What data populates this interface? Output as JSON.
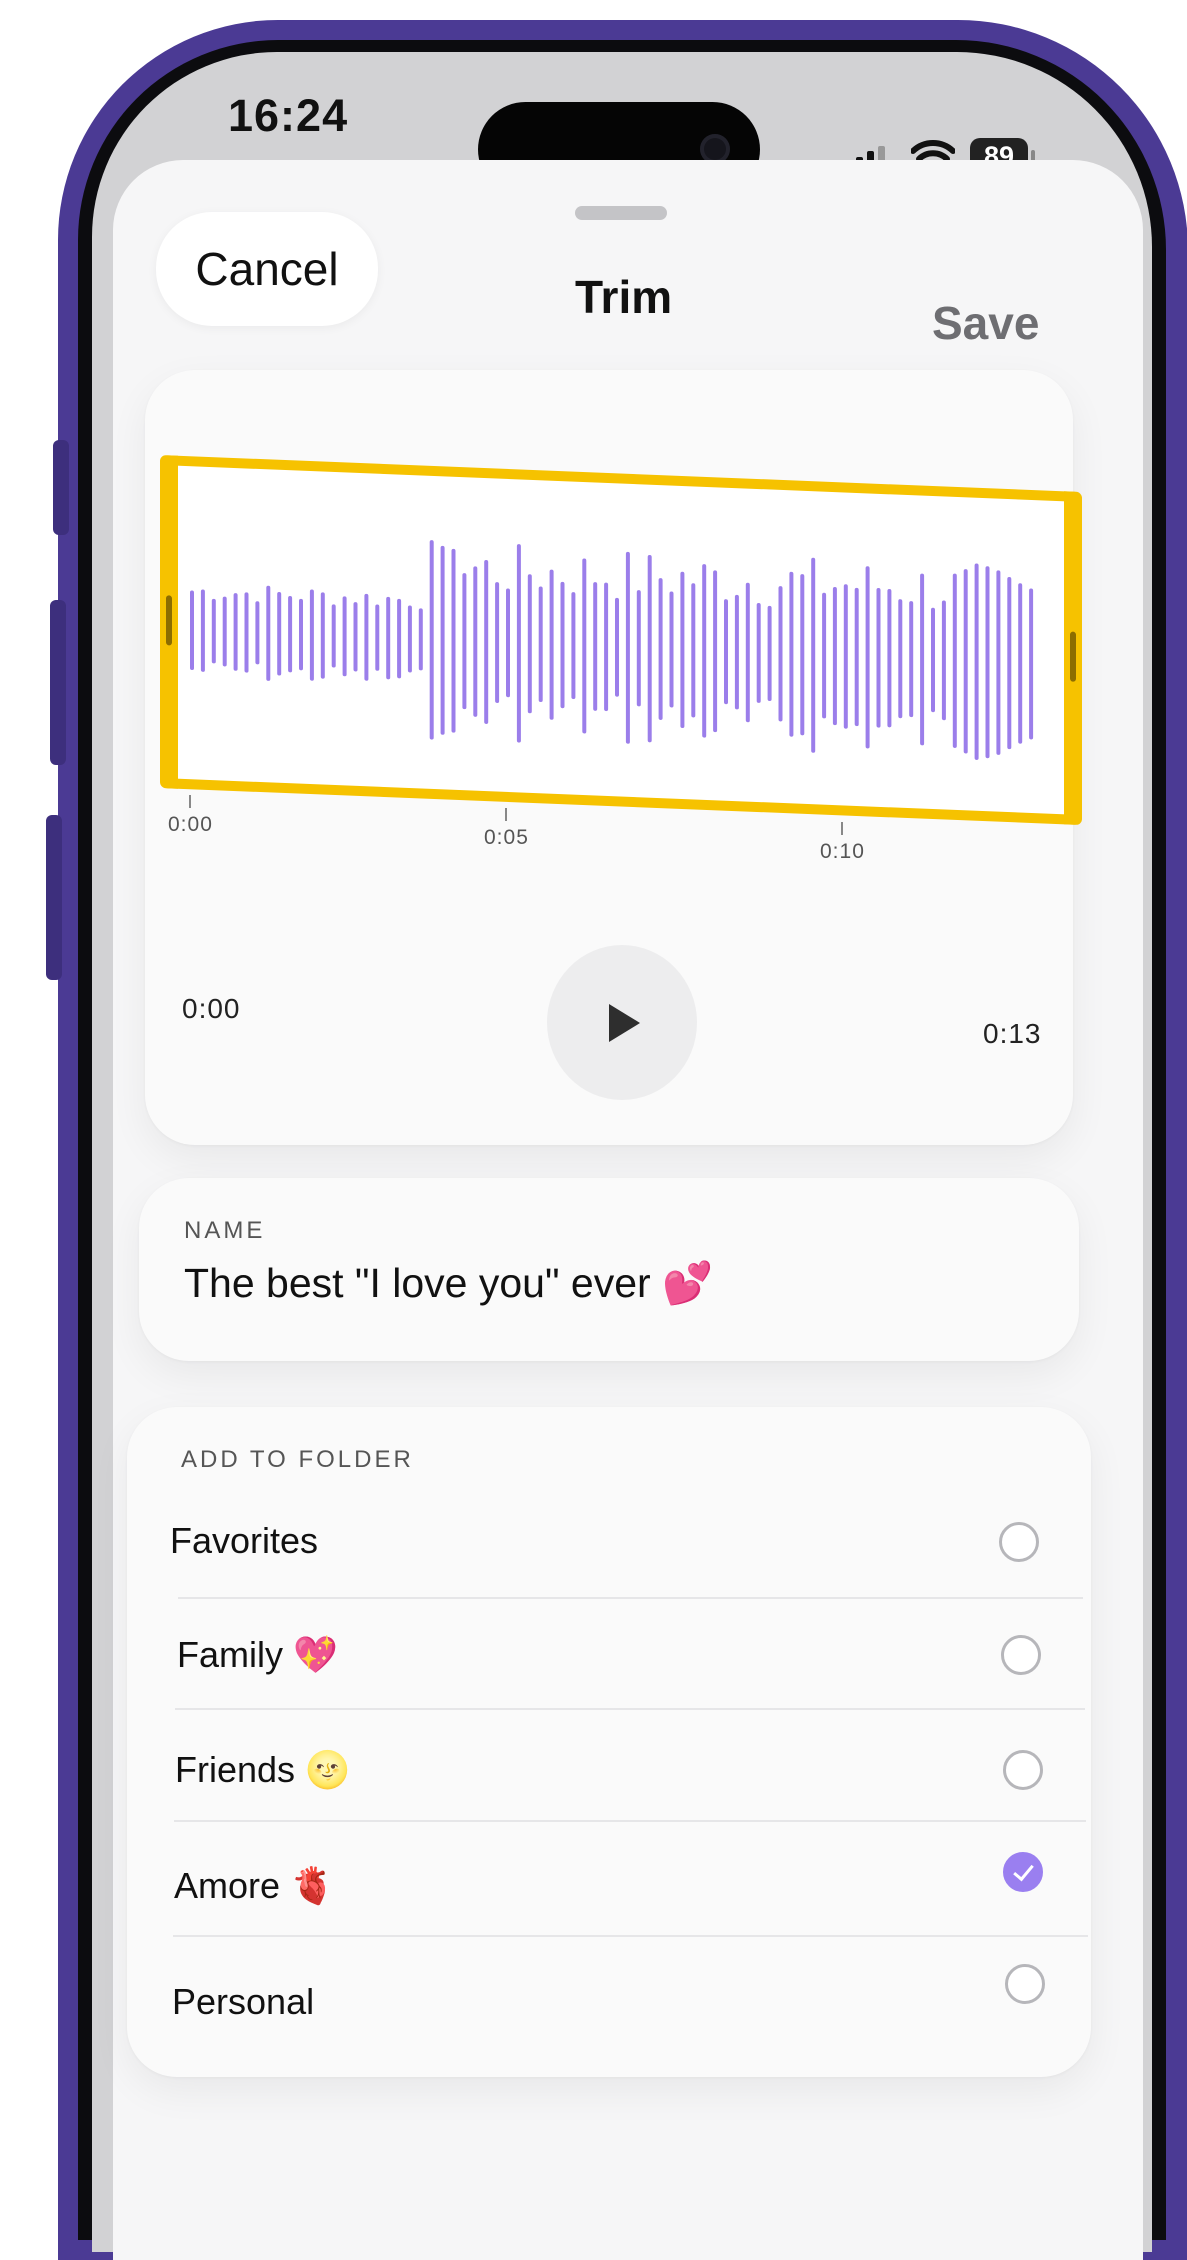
{
  "status_bar": {
    "time": "16:24",
    "battery_level": 89,
    "battery_text": "89",
    "icons": [
      "cellular-signal-icon",
      "wifi-icon",
      "battery-icon"
    ]
  },
  "nav": {
    "cancel_label": "Cancel",
    "title": "Trim",
    "save_label": "Save"
  },
  "trim": {
    "timeline_ticks": [
      "0:00",
      "0:05",
      "0:10"
    ],
    "current_time": "0:00",
    "total_time": "0:13",
    "selection_color": "#F6C200",
    "waveform_color": "#9B7EEA"
  },
  "name_section": {
    "label": "NAME",
    "value": "The best \"I love you\" ever 💕"
  },
  "folder_section": {
    "label": "ADD TO FOLDER",
    "folders": [
      {
        "label": "Favorites",
        "checked": false
      },
      {
        "label": "Family 💖",
        "checked": false
      },
      {
        "label": "Friends 🌝",
        "checked": false
      },
      {
        "label": "Amore 🫀",
        "checked": true
      },
      {
        "label": "Personal",
        "checked": false
      }
    ]
  },
  "colors": {
    "device_frame": "#4B3A94",
    "accent_purple": "#9A7FF0",
    "trim_yellow": "#F6C200"
  }
}
